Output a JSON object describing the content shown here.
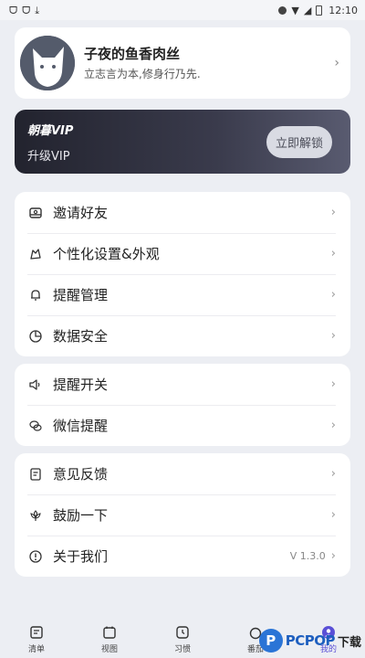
{
  "status_bar": {
    "left_icons": [
      "app-icon",
      "app-icon",
      "download-icon"
    ],
    "time": "12:10"
  },
  "profile": {
    "name": "子夜的鱼香肉丝",
    "motto": "立志言为本,修身行乃先."
  },
  "vip": {
    "title": "朝暮VIP",
    "subtitle": "升级VIP",
    "button": "立即解锁"
  },
  "menu_group_1": [
    {
      "label": "邀请好友",
      "icon": "invite-icon"
    },
    {
      "label": "个性化设置&外观",
      "icon": "theme-icon"
    },
    {
      "label": "提醒管理",
      "icon": "bell-icon"
    },
    {
      "label": "数据安全",
      "icon": "pie-chart-icon"
    }
  ],
  "menu_group_2": [
    {
      "label": "提醒开关",
      "icon": "speaker-icon"
    },
    {
      "label": "微信提醒",
      "icon": "wechat-icon"
    }
  ],
  "menu_group_3": [
    {
      "label": "意见反馈",
      "icon": "feedback-icon"
    },
    {
      "label": "鼓励一下",
      "icon": "flower-icon"
    },
    {
      "label": "关于我们",
      "icon": "info-icon",
      "meta": "V 1.3.0"
    }
  ],
  "tabs": [
    {
      "label": "清单",
      "icon": "list-icon"
    },
    {
      "label": "视图",
      "icon": "calendar-icon"
    },
    {
      "label": "习惯",
      "icon": "clock-icon"
    },
    {
      "label": "番茄",
      "icon": "timer-icon"
    },
    {
      "label": "我的",
      "icon": "profile-icon"
    }
  ],
  "watermark": {
    "brand": "PCPOP",
    "suffix": "下载"
  }
}
